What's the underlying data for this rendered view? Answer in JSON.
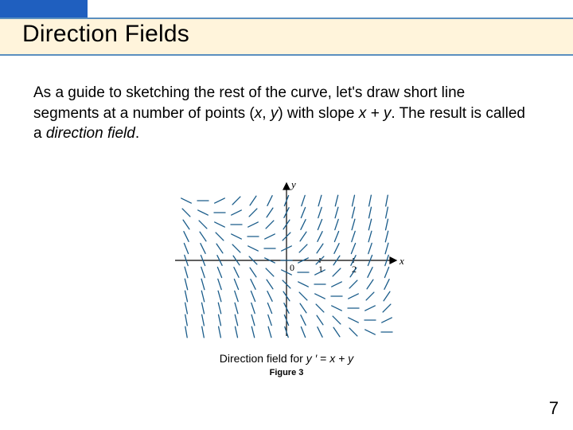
{
  "title": "Direction Fields",
  "body": {
    "prefix": "As a guide to sketching the rest of the curve, let's draw short line segments at a number of points (",
    "x": "x",
    "comma": ", ",
    "y": "y",
    "mid": ") with slope ",
    "slope": "x + y",
    "period1": ". The result is called a ",
    "term": "direction field",
    "period2": "."
  },
  "caption": {
    "prefix": "Direction field for ",
    "lhs": "y ′",
    "eq": " = ",
    "rhs": "x + y"
  },
  "figure_label": "Figure 3",
  "axes": {
    "origin": "0",
    "x1": "1",
    "x2": "2",
    "xlab": "x",
    "ylab": "y"
  },
  "page_number": "7",
  "chart_data": {
    "type": "other",
    "description": "Direction field (slope field) for dy/dx = x + y",
    "equation": "y' = x + y",
    "slope_rule": "slope at (x, y) = x + y",
    "x_range": [
      -3,
      3
    ],
    "y_range": [
      -3,
      3
    ],
    "grid_step": 0.5,
    "segments": "short line segment at each half-integer lattice point with slope x+y",
    "xticks": [
      0,
      1,
      2
    ],
    "notes": "Segments on the line y = -x are horizontal (slope 0); slopes positive above/right of that line, negative below/left."
  }
}
